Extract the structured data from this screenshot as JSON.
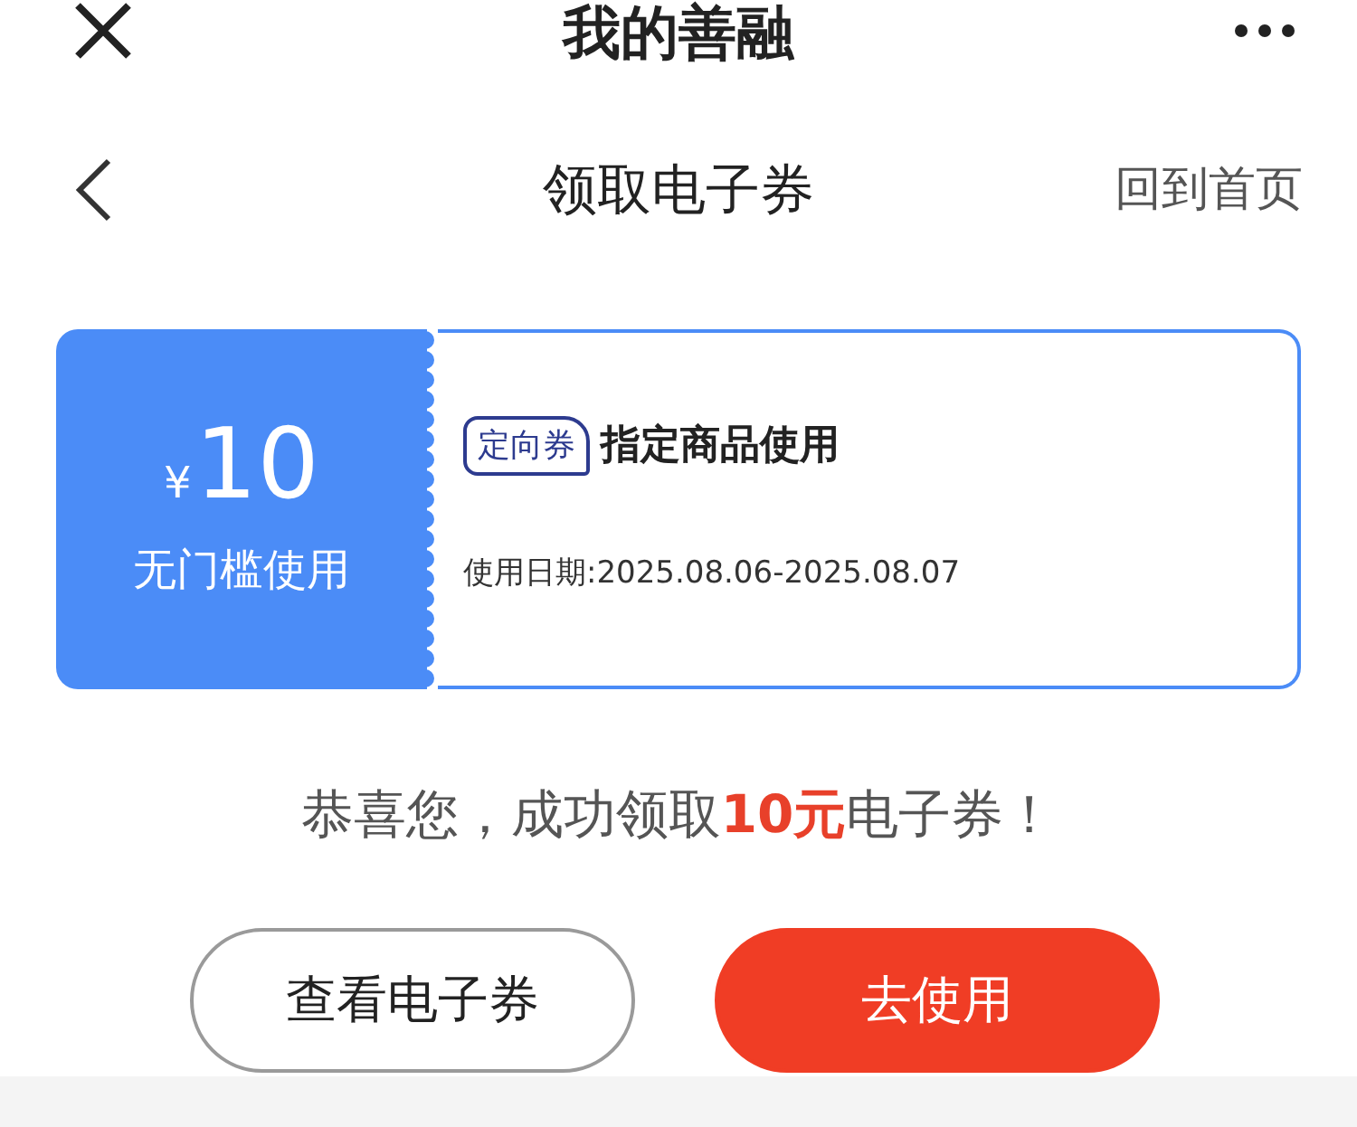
{
  "window": {
    "title": "我的善融"
  },
  "nav": {
    "title": "领取电子券",
    "home_link": "回到首页"
  },
  "coupon": {
    "currency": "¥",
    "amount": "10",
    "condition": "无门槛使用",
    "tag": "定向券",
    "name": "指定商品使用",
    "date": "使用日期:2025.08.06-2025.08.07"
  },
  "message": "恭喜您，成功领取**10元**电子券！",
  "buttons": [
    {
      "label": "查看电子券",
      "kind": "outline"
    },
    {
      "label": "去使用",
      "kind": "primary"
    }
  ]
}
